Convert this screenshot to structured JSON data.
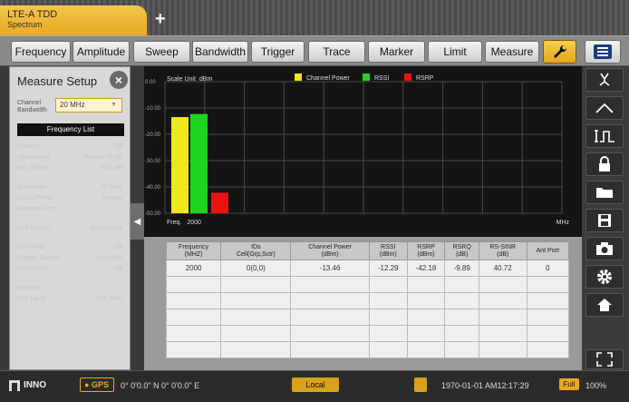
{
  "mode_tab": {
    "title": "LTE-A TDD",
    "subtitle": "Spectrum"
  },
  "add_tab": "+",
  "menu": [
    "Frequency",
    "Amplitude",
    "Sweep",
    "Bandwidth",
    "Trigger",
    "Trace",
    "Marker",
    "Limit",
    "Measure"
  ],
  "setup_panel": {
    "title": "Measure Setup",
    "bandwidth_label": "Channel Bandwidth",
    "bandwidth_value": "20 MHz",
    "frequency_list_button": "Frequency List",
    "faint_rows": [
      [
        "Preamp",
        "Off"
      ],
      [
        "Attenuation",
        "Manual 10 dB"
      ],
      [
        "Ext. Offset",
        "0.00 dB"
      ],
      [
        "Subframe",
        "20 MHz"
      ],
      [
        "Cyclic Prefix",
        "Normal"
      ],
      [
        "Antenna Port",
        "0"
      ],
      [
        "Cell Search",
        "Continuous"
      ],
      [
        "Max Hold",
        "Off"
      ],
      [
        "Trigger Source",
        "Free Run"
      ],
      [
        "Reference",
        "Off"
      ],
      [
        "Antenna",
        "1"
      ],
      [
        "Ref. Level",
        "0.00 dBm"
      ]
    ]
  },
  "chart_data": {
    "type": "bar",
    "scale_unit_label": "Scale Unit",
    "scale_unit": "dBm",
    "categories": [
      "Channel Power",
      "RSSI",
      "RSRP"
    ],
    "values": [
      -13.46,
      -12.29,
      -42.18
    ],
    "colors": [
      "#f0e61c",
      "#1ed41e",
      "#e81414"
    ],
    "ylim": [
      -50,
      0
    ],
    "y_ticks": [
      "0.00",
      "-10.00",
      "-20.00",
      "-30.00",
      "-40.00",
      "-50.00"
    ],
    "x_start_label": "Freq.",
    "x_start_value": "2000",
    "x_unit": "MHz",
    "legend_position": "top"
  },
  "table": {
    "headers": [
      [
        "Frequency",
        "(MHZ)"
      ],
      [
        "IDs",
        "Cell(Grp,Sctr)"
      ],
      [
        "Channel Power",
        "(dBm)"
      ],
      [
        "RSSI",
        "(dBm)"
      ],
      [
        "RSRP",
        "(dBm)"
      ],
      [
        "RSRQ",
        "(dB)"
      ],
      [
        "RS-SINR",
        "(dB)"
      ],
      [
        "Ant Port",
        ""
      ]
    ],
    "rows": [
      [
        "2000",
        "0(0,0)",
        "-13.46",
        "-12.29",
        "-42.18",
        "-9.89",
        "40.72",
        "0"
      ],
      [
        "",
        "",
        "",
        "",
        "",
        "",
        "",
        ""
      ],
      [
        "",
        "",
        "",
        "",
        "",
        "",
        "",
        ""
      ],
      [
        "",
        "",
        "",
        "",
        "",
        "",
        "",
        ""
      ],
      [
        "",
        "",
        "",
        "",
        "",
        "",
        "",
        ""
      ],
      [
        "",
        "",
        "",
        "",
        "",
        "",
        "",
        ""
      ]
    ]
  },
  "right_toolbar": [
    "antenna-icon",
    "peak-icon",
    "pulse-icon",
    "lock-icon",
    "folder-icon",
    "save-icon",
    "camera-icon",
    "settings-icon",
    "home-icon",
    "fullscreen-icon"
  ],
  "status": {
    "brand": "INNO",
    "gps_label": "GPS",
    "gps_coords": "0° 0'0.0\" N 0° 0'0.0\" E",
    "local_label": "Local",
    "datetime": "1970-01-01  AM12:17:29",
    "battery_label": "Full",
    "battery_percent": "100%"
  },
  "colors": {
    "accent": "#e8a923",
    "chart_bg": "#141414"
  }
}
